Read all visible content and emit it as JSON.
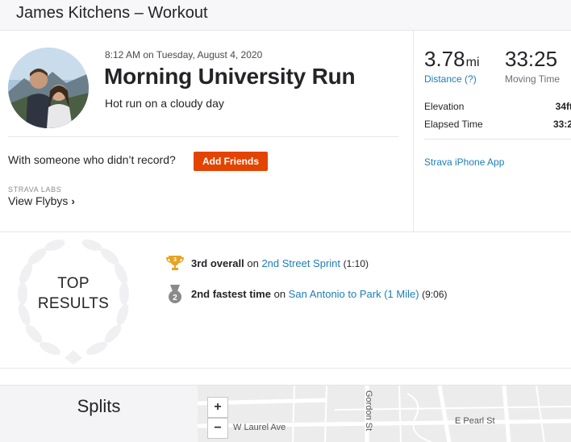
{
  "header": {
    "title": "James Kitchens – Workout"
  },
  "activity": {
    "datetime": "8:12 AM on Tuesday, August 4, 2020",
    "name": "Morning University Run",
    "description": "Hot run on a cloudy day",
    "with_someone_text": "With someone who didn’t record?",
    "add_friends_label": "Add Friends",
    "labs_label": "STRAVA LABS",
    "flybys_label": "View Flybys",
    "flybys_chevron": "›"
  },
  "stats": {
    "distance": {
      "value": "3.78",
      "unit": "mi",
      "label": "Distance (?)"
    },
    "moving_time": {
      "value": "33:25",
      "label": "Moving Time"
    },
    "elevation": {
      "label": "Elevation",
      "value": "34ft"
    },
    "elapsed_time": {
      "label": "Elapsed Time",
      "value": "33:2"
    },
    "app_link": "Strava iPhone App"
  },
  "results": {
    "label_line1": "TOP",
    "label_line2": "RESULTS",
    "achievements": [
      {
        "rank": "3rd overall",
        "connector": " on ",
        "segment": "2nd Street Sprint",
        "time": "(1:10)",
        "medal_number": "3",
        "medal_color": "#e8a321"
      },
      {
        "rank": "2nd fastest time",
        "connector": " on ",
        "segment": "San Antonio to Park (1 Mile)",
        "time": "(9:06)",
        "medal_number": "2",
        "medal_color": "#8a8a8a"
      }
    ]
  },
  "splits": {
    "label": "Splits"
  },
  "map": {
    "zoom_in": "+",
    "zoom_out": "−",
    "streets": {
      "laurel": "W Laurel Ave",
      "gordon": "Gordon St",
      "pearl": "E Pearl St"
    }
  },
  "colors": {
    "accent": "#e34402",
    "link": "#1d7db8"
  }
}
